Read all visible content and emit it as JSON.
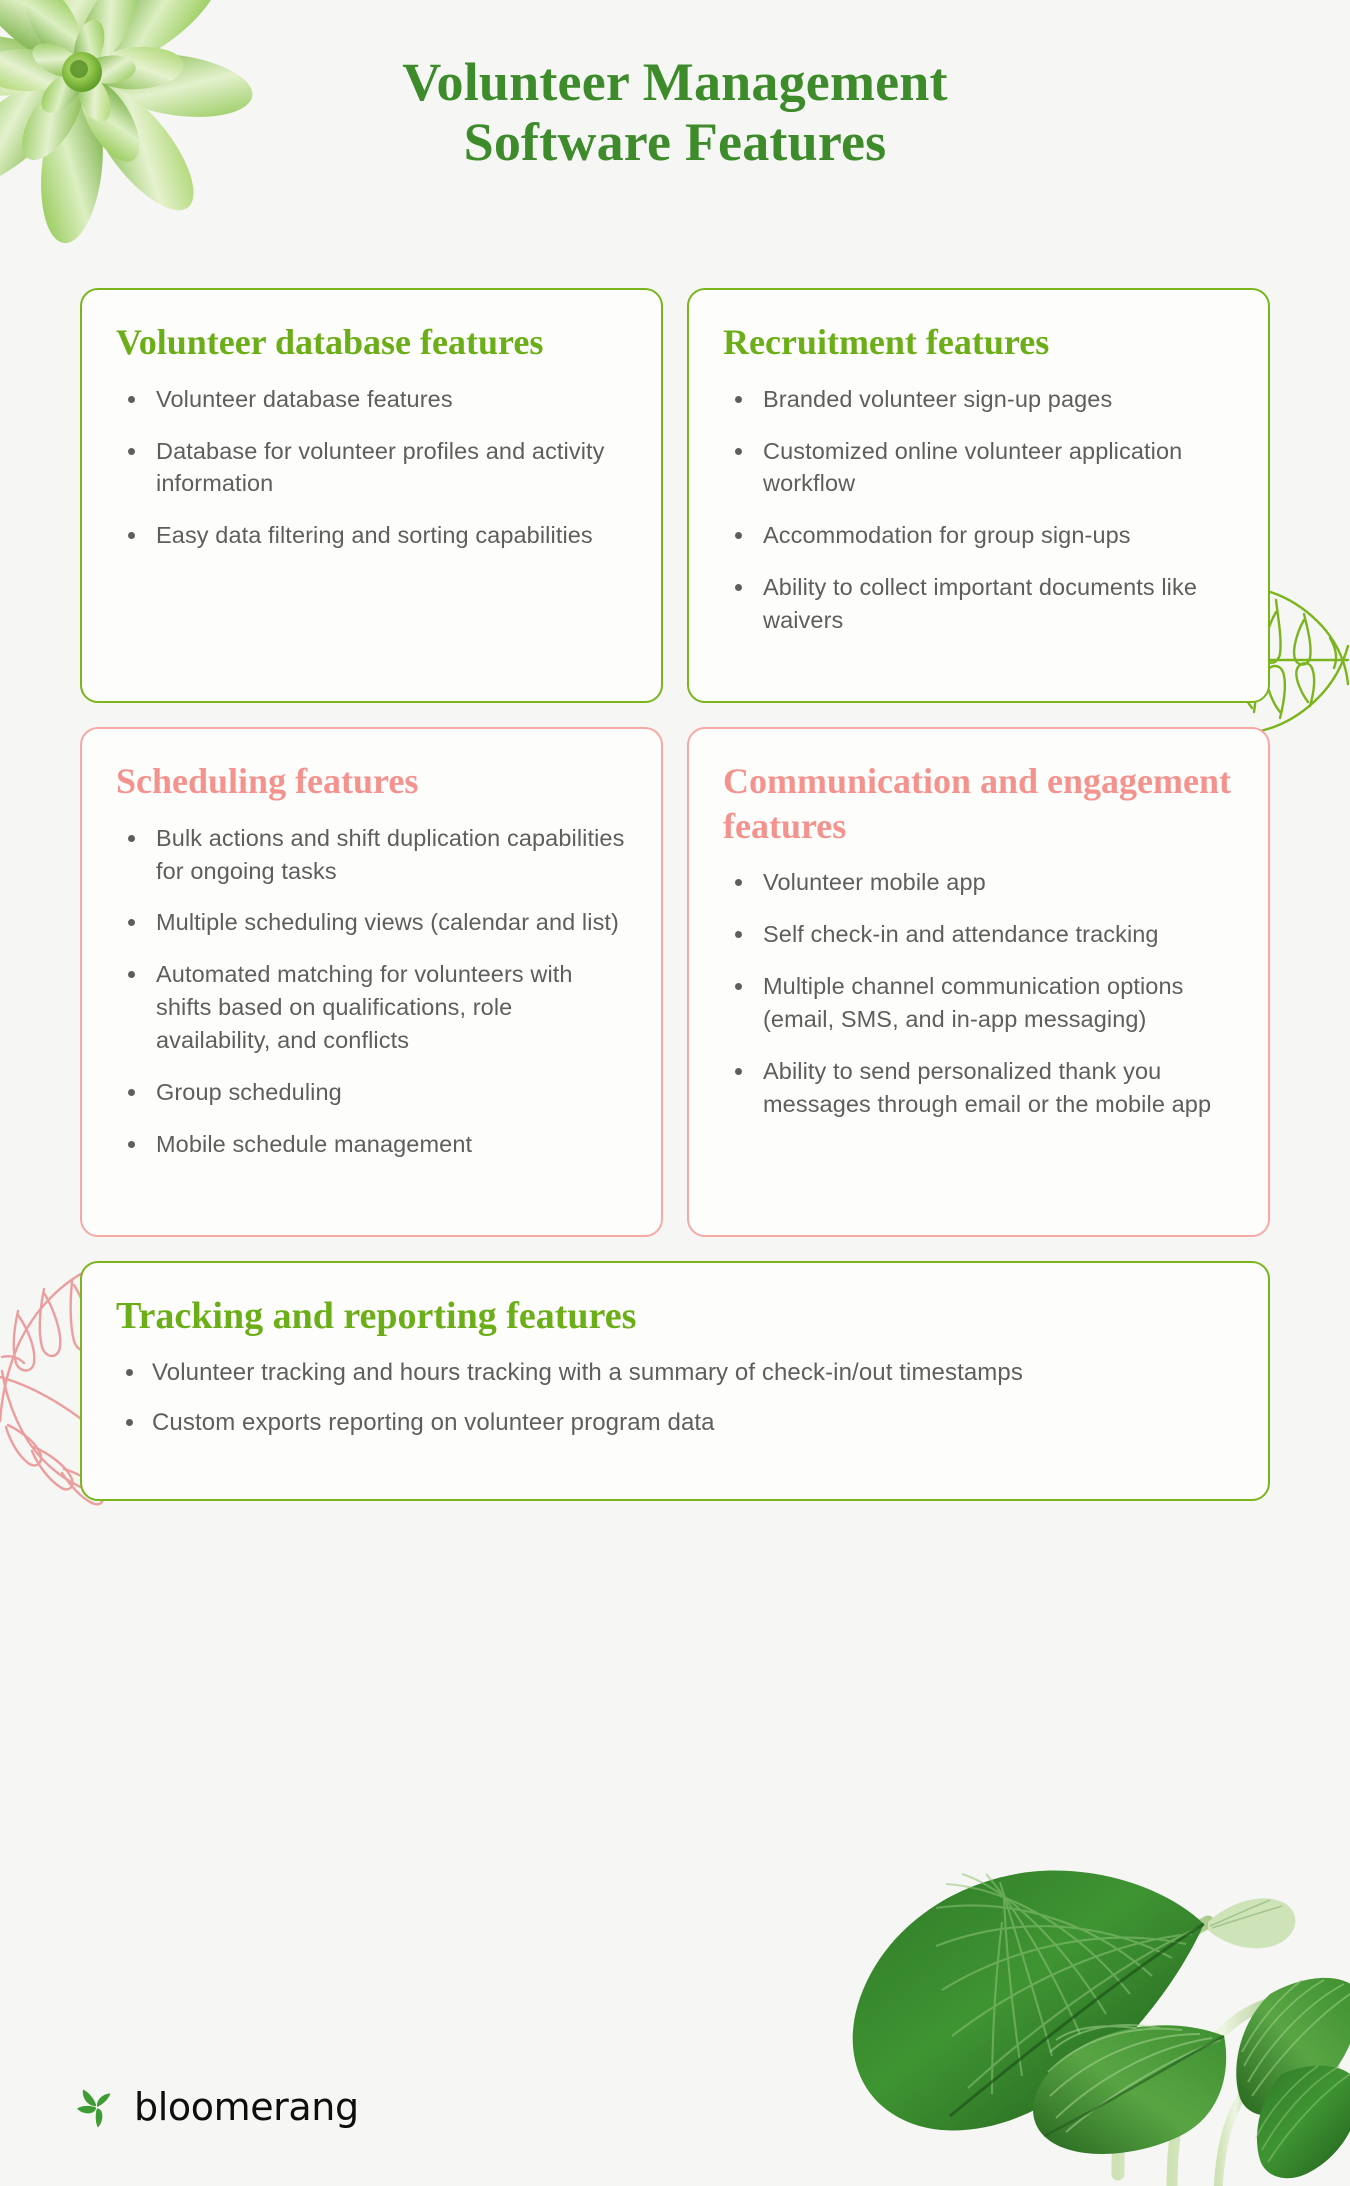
{
  "title": {
    "line1": "Volunteer Management",
    "line2": "Software Features"
  },
  "colors": {
    "background": "#f6f6f4",
    "title_green": "#3d8b2a",
    "card_green": "#6cae17",
    "border_green": "#7ab51d",
    "card_pink": "#f4938e",
    "border_pink": "#f6a9a5",
    "body_text": "#5e5f5a",
    "logo_green": "#3f9c35",
    "logo_word": "#0e0e0e"
  },
  "cards": [
    {
      "id": "volunteer-database",
      "theme": "green",
      "title": "Volunteer database features",
      "bullets": [
        "Volunteer database features",
        "Database for volunteer profiles and activity information",
        "Easy data filtering and sorting capabilities"
      ]
    },
    {
      "id": "recruitment",
      "theme": "green",
      "title": "Recruitment features",
      "bullets": [
        "Branded volunteer sign-up pages",
        "Customized online volunteer application workflow",
        "Accommodation for group sign-ups",
        "Ability to collect important documents like waivers"
      ]
    },
    {
      "id": "scheduling",
      "theme": "pink",
      "title": "Scheduling features",
      "bullets": [
        "Bulk actions and shift duplication capabilities for ongoing tasks",
        "Multiple scheduling views (calendar and list)",
        "Automated matching for volunteers with shifts based on qualifications, role availability, and conflicts",
        "Group scheduling",
        "Mobile schedule management"
      ]
    },
    {
      "id": "communication",
      "theme": "pink",
      "title": "Communication and engagement features",
      "bullets": [
        "Volunteer mobile app",
        "Self check-in and attendance tracking",
        "Multiple channel communication options (email, SMS, and in-app messaging)",
        "Ability to send personalized thank you messages through email or the mobile app"
      ]
    },
    {
      "id": "tracking-reporting",
      "theme": "green",
      "title": "Tracking and reporting features",
      "bullets": [
        "Volunteer tracking and hours tracking with a summary of check-in/out timestamps",
        "Custom exports reporting on volunteer program data"
      ]
    }
  ],
  "logo": {
    "wordmark": "bloomerang",
    "mark_icon": "bloomerang-trefoil-icon"
  },
  "decorations": [
    {
      "name": "succulent-photo",
      "position": "top-left"
    },
    {
      "name": "monstera-outline-green",
      "position": "right-edge"
    },
    {
      "name": "monstera-outline-pink",
      "position": "left-edge"
    },
    {
      "name": "calathea-photo",
      "position": "bottom-right"
    }
  ]
}
